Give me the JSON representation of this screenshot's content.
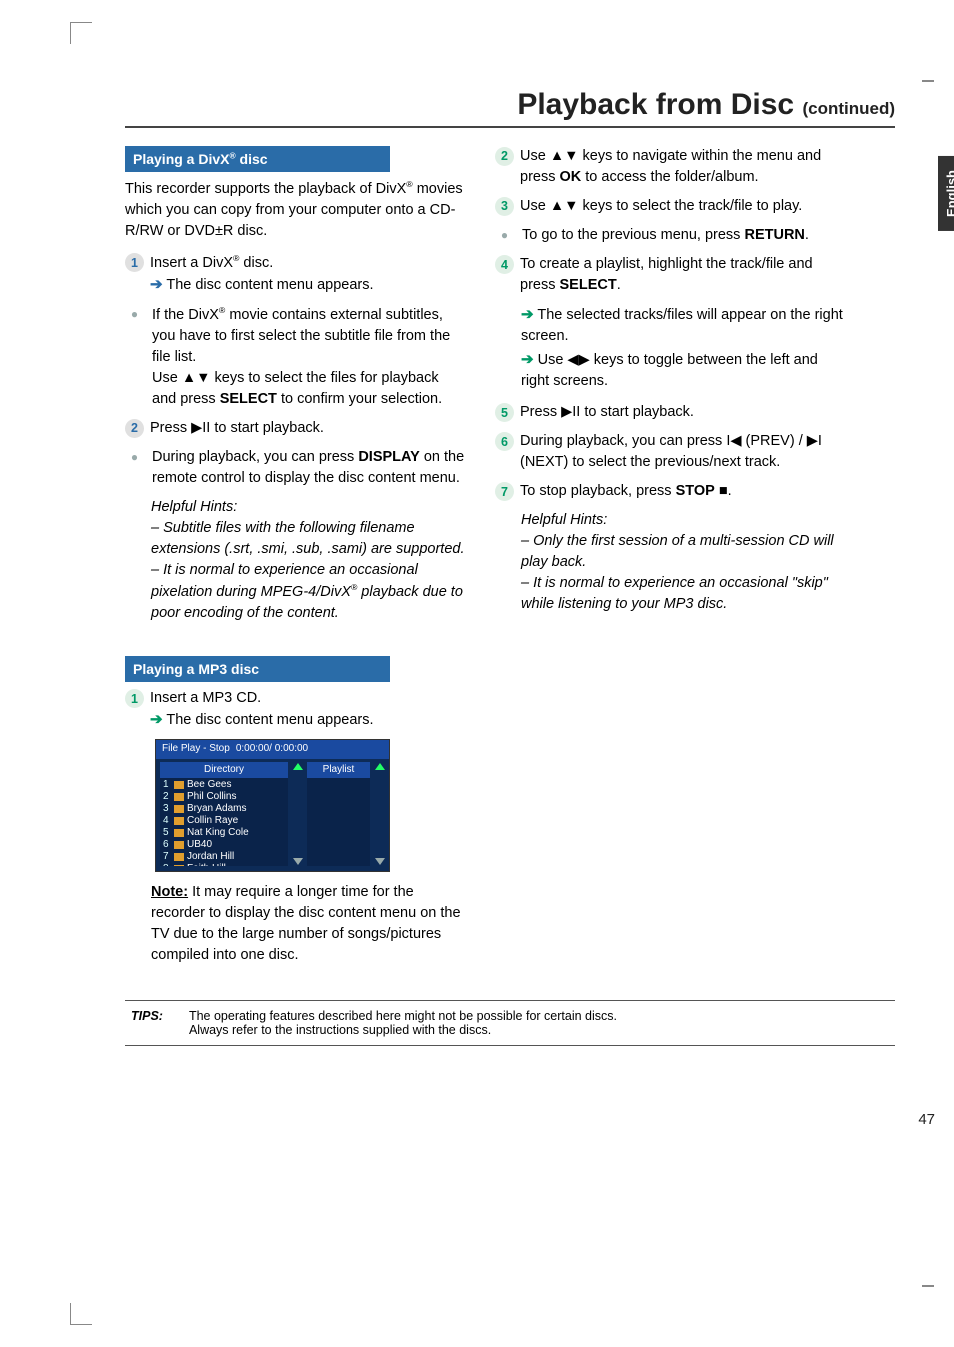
{
  "title_main": "Playback from Disc ",
  "title_cont": "(continued)",
  "tab": "English",
  "divx": {
    "heading_pre": "Playing a DivX",
    "heading_post": " disc",
    "intro_1": "This recorder supports the playback of DivX",
    "intro_2": " movies which you can copy from your computer onto a CD-R/RW or DVD±R disc.",
    "step1_a": "Insert a DivX",
    "step1_b": " disc.",
    "step1_arrow": " The disc content menu appears.",
    "bullet_1": "If the DivX",
    "bullet_2": " movie contains external subtitles, you have to first select the subtitle file from the file list.",
    "bullet_3a": "Use ",
    "bullet_3b": " keys to select the files for playback and press ",
    "bullet_3c": "SELECT",
    "bullet_3d": " to confirm your selection.",
    "step2_a": "Press ",
    "step2_b": " to start playback.",
    "bullet2_a": "During playback, you can press ",
    "bullet2_b": "DISPLAY",
    "bullet2_c": " on the remote control to display the disc content menu.",
    "hints_head": "Helpful Hints:",
    "hints_1": "– Subtitle files with the following filename extensions (.srt, .smi, .sub, .sami) are supported.",
    "hints_2a": "– It is normal to experience an occasional pixelation during MPEG-4/DivX",
    "hints_2b": " playback due to poor encoding of the content."
  },
  "mp3": {
    "heading": "Playing a MP3 disc",
    "step1": "Insert a MP3 CD.",
    "step1_arrow": " The disc content menu appears.",
    "note_a": "Note:",
    "note_b": " It may require a longer time for the recorder to display the disc content menu on the TV due to the large number of songs/pictures compiled into one disc."
  },
  "right": {
    "step2_a": "Use ",
    "step2_b": " keys to navigate within the menu and press ",
    "step2_c": "OK",
    "step2_d": " to access the folder/album.",
    "step3_a": "Use ",
    "step3_b": " keys to select the track/file to play.",
    "bullet_a": "To go to the previous menu, press ",
    "bullet_b": "RETURN",
    "bullet_c": ".",
    "step4_a": "To create a playlist, highlight the track/file and press ",
    "step4_b": "SELECT",
    "step4_c": ".",
    "step4_arr1": " The selected tracks/files will appear on the right screen.",
    "step4_arr2a": " Use ",
    "step4_arr2b": " keys to toggle between the left and right screens.",
    "step5_a": "Press ",
    "step5_b": " to start playback.",
    "step6_a": "During playback, you can press ",
    "step6_b": " (PREV) / ",
    "step6_c": " (NEXT) to select the previous/next track.",
    "step7_a": "To stop playback, press ",
    "step7_b": "STOP",
    "step7_c": " ",
    "step7_d": ".",
    "hints_head": "Helpful Hints:",
    "hints_1": "– Only the first session of a multi-session CD will play back.",
    "hints_2": "– It is normal to experience an occasional \"skip\" while listening to your MP3 disc."
  },
  "screenshot": {
    "header_a": "File Play - Stop",
    "header_b": "0:00:00/ 0:00:00",
    "dir": "Directory",
    "playlist": "Playlist",
    "files": [
      "Bee Gees",
      "Phil Collins",
      "Bryan Adams",
      "Collin Raye",
      "Nat King Cole",
      "UB40",
      "Jordan Hill",
      "Faith Hill"
    ]
  },
  "tips": {
    "label": "TIPS:",
    "line1": "The operating features described here might not be possible for certain discs.",
    "line2": "Always refer to the instructions supplied with the discs."
  },
  "pagenum": "47"
}
